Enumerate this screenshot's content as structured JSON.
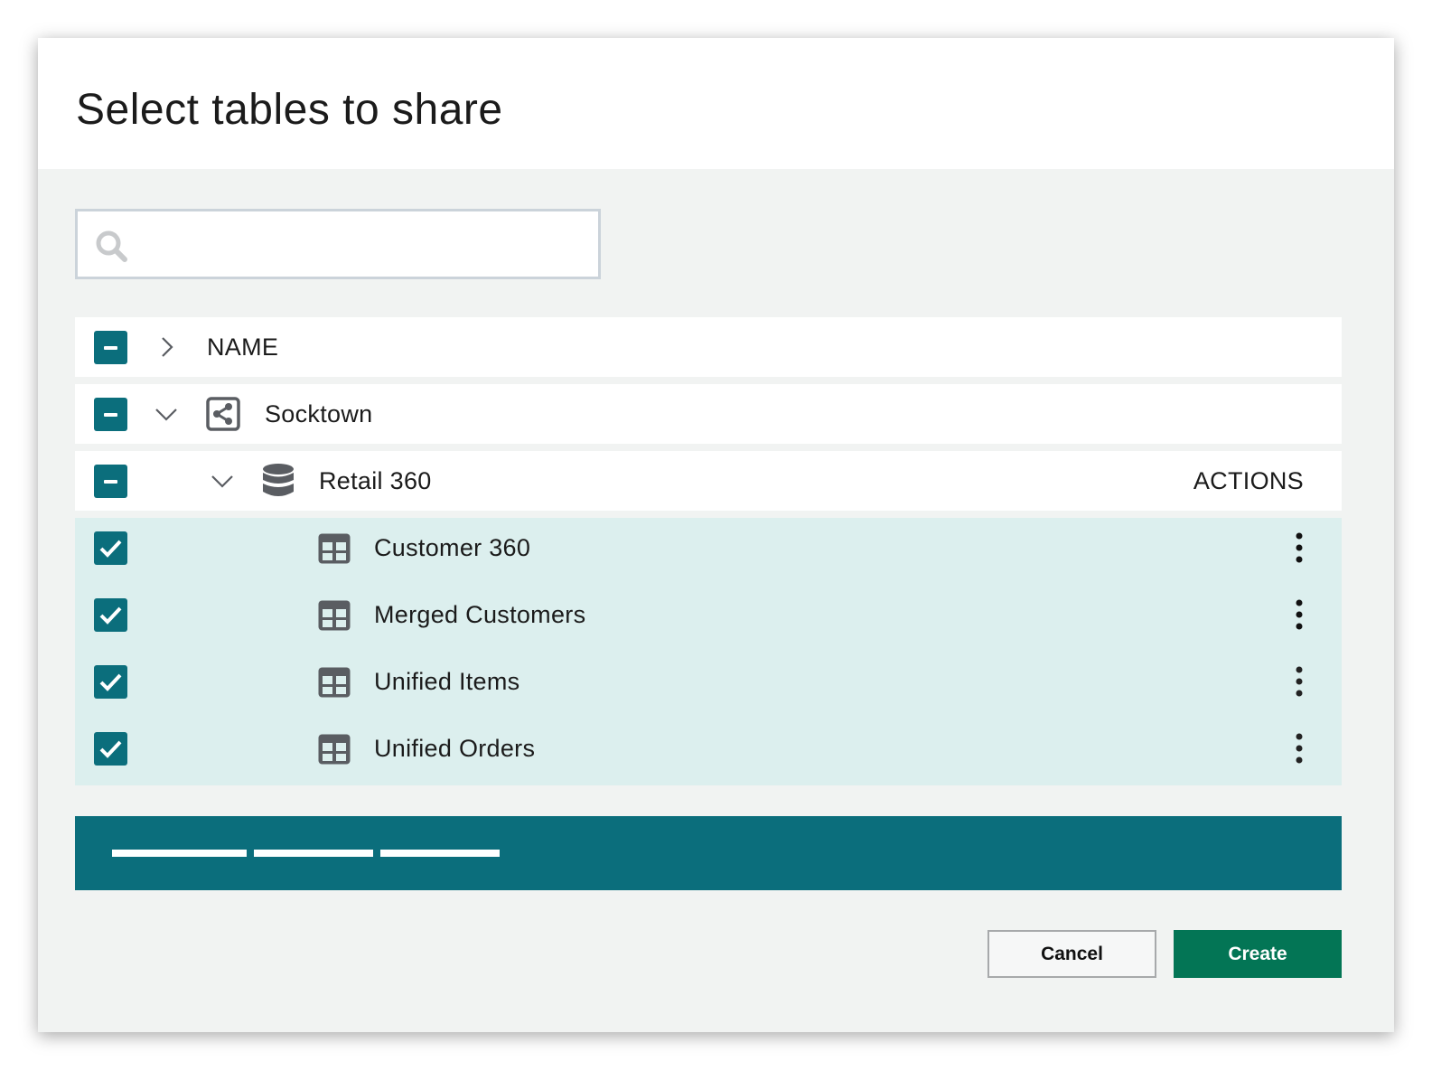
{
  "dialog": {
    "title": "Select tables to share"
  },
  "search": {
    "value": "",
    "placeholder": "",
    "icon": "search-icon"
  },
  "table": {
    "header": {
      "name_label": "NAME",
      "checkbox_state": "indeterminate",
      "expand_state": "collapsed"
    },
    "actions_label": "ACTIONS",
    "rows": [
      {
        "level": 0,
        "label": "Socktown",
        "icon": "share-icon",
        "checkbox_state": "indeterminate",
        "expand_state": "expanded",
        "selected": false
      },
      {
        "level": 1,
        "label": "Retail 360",
        "icon": "database-icon",
        "checkbox_state": "indeterminate",
        "expand_state": "expanded",
        "selected": false
      },
      {
        "level": 2,
        "label": "Customer 360",
        "icon": "table-icon",
        "checkbox_state": "checked",
        "selected": true
      },
      {
        "level": 2,
        "label": "Merged Customers",
        "icon": "table-icon",
        "checkbox_state": "checked",
        "selected": true
      },
      {
        "level": 2,
        "label": "Unified Items",
        "icon": "table-icon",
        "checkbox_state": "checked",
        "selected": true
      },
      {
        "level": 2,
        "label": "Unified Orders",
        "icon": "table-icon",
        "checkbox_state": "checked",
        "selected": true
      }
    ]
  },
  "footer": {
    "cancel_label": "Cancel",
    "create_label": "Create"
  },
  "colors": {
    "accent_teal": "#0b6e7c",
    "primary_green": "#037555",
    "selected_row": "#dcefee",
    "body_bg": "#f1f3f2"
  }
}
